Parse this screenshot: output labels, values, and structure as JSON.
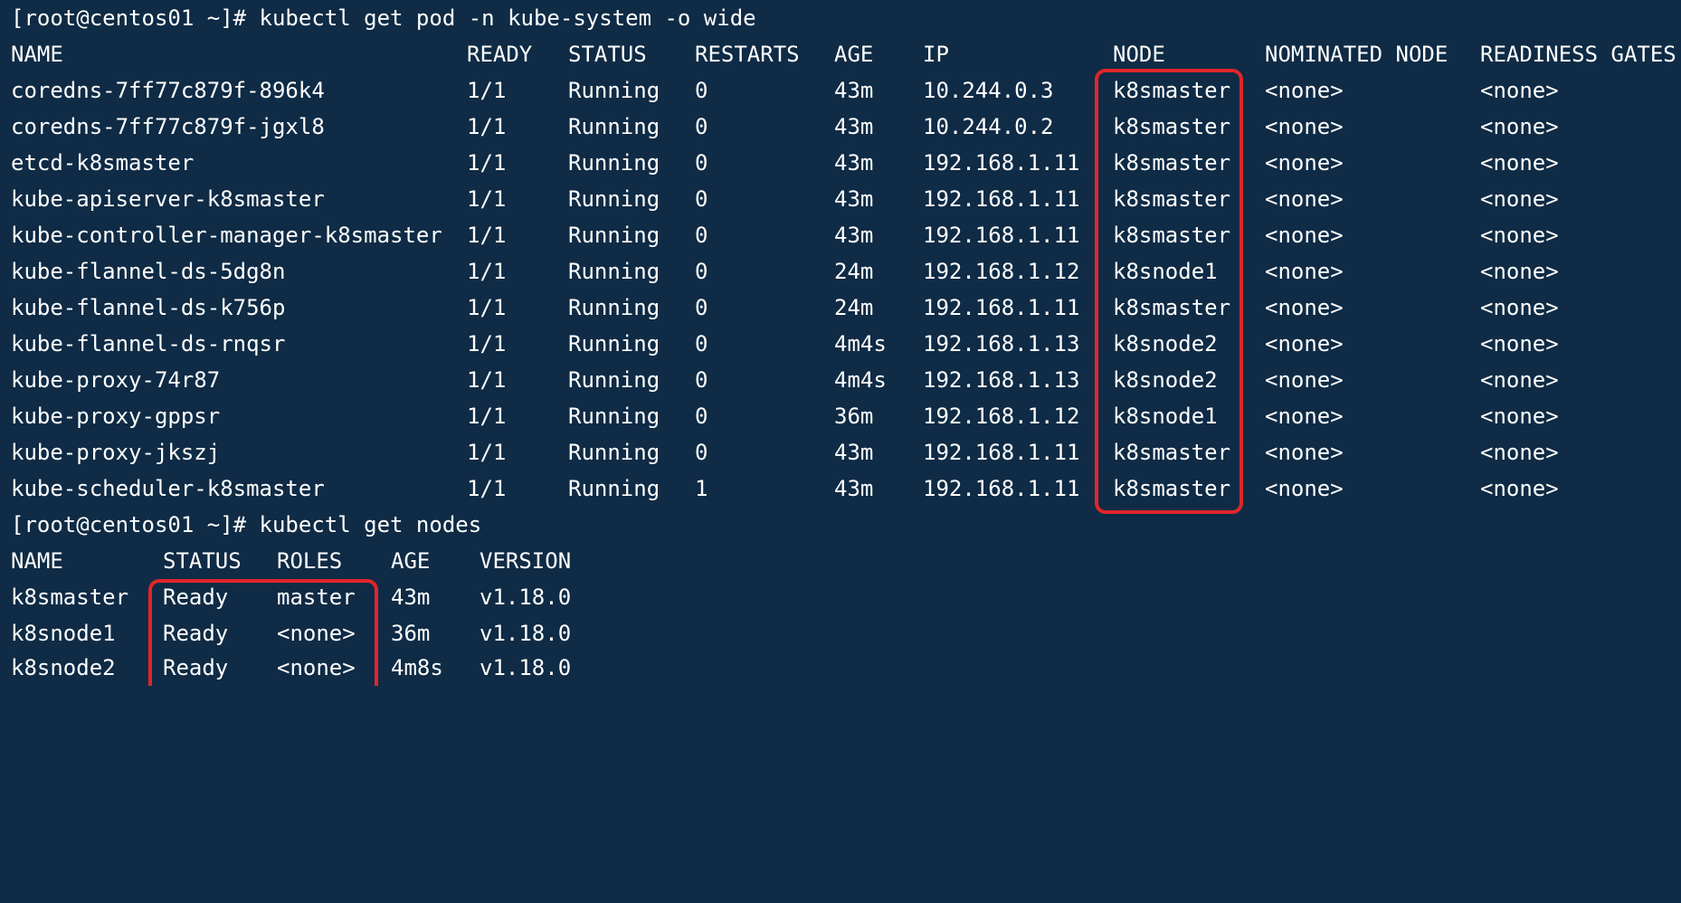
{
  "commands": {
    "pods": "[root@centos01 ~]# kubectl get pod -n kube-system -o wide",
    "nodes": "[root@centos01 ~]# kubectl get nodes"
  },
  "pods": {
    "headers": [
      "NAME",
      "READY",
      "STATUS",
      "RESTARTS",
      "AGE",
      "IP",
      "NODE",
      "NOMINATED NODE",
      "READINESS GATES"
    ],
    "rows": [
      [
        "coredns-7ff77c879f-896k4",
        "1/1",
        "Running",
        "0",
        "43m",
        "10.244.0.3",
        "k8smaster",
        "<none>",
        "<none>"
      ],
      [
        "coredns-7ff77c879f-jgxl8",
        "1/1",
        "Running",
        "0",
        "43m",
        "10.244.0.2",
        "k8smaster",
        "<none>",
        "<none>"
      ],
      [
        "etcd-k8smaster",
        "1/1",
        "Running",
        "0",
        "43m",
        "192.168.1.11",
        "k8smaster",
        "<none>",
        "<none>"
      ],
      [
        "kube-apiserver-k8smaster",
        "1/1",
        "Running",
        "0",
        "43m",
        "192.168.1.11",
        "k8smaster",
        "<none>",
        "<none>"
      ],
      [
        "kube-controller-manager-k8smaster",
        "1/1",
        "Running",
        "0",
        "43m",
        "192.168.1.11",
        "k8smaster",
        "<none>",
        "<none>"
      ],
      [
        "kube-flannel-ds-5dg8n",
        "1/1",
        "Running",
        "0",
        "24m",
        "192.168.1.12",
        "k8snode1",
        "<none>",
        "<none>"
      ],
      [
        "kube-flannel-ds-k756p",
        "1/1",
        "Running",
        "0",
        "24m",
        "192.168.1.11",
        "k8smaster",
        "<none>",
        "<none>"
      ],
      [
        "kube-flannel-ds-rnqsr",
        "1/1",
        "Running",
        "0",
        "4m4s",
        "192.168.1.13",
        "k8snode2",
        "<none>",
        "<none>"
      ],
      [
        "kube-proxy-74r87",
        "1/1",
        "Running",
        "0",
        "4m4s",
        "192.168.1.13",
        "k8snode2",
        "<none>",
        "<none>"
      ],
      [
        "kube-proxy-gppsr",
        "1/1",
        "Running",
        "0",
        "36m",
        "192.168.1.12",
        "k8snode1",
        "<none>",
        "<none>"
      ],
      [
        "kube-proxy-jkszj",
        "1/1",
        "Running",
        "0",
        "43m",
        "192.168.1.11",
        "k8smaster",
        "<none>",
        "<none>"
      ],
      [
        "kube-scheduler-k8smaster",
        "1/1",
        "Running",
        "1",
        "43m",
        "192.168.1.11",
        "k8smaster",
        "<none>",
        "<none>"
      ]
    ]
  },
  "nodes": {
    "headers": [
      "NAME",
      "STATUS",
      "ROLES",
      "AGE",
      "VERSION"
    ],
    "rows": [
      [
        "k8smaster",
        "Ready",
        "master",
        "43m",
        "v1.18.0"
      ],
      [
        "k8snode1",
        "Ready",
        "<none>",
        "36m",
        "v1.18.0"
      ],
      [
        "k8snode2",
        "Ready",
        "<none>",
        "4m8s",
        "v1.18.0"
      ]
    ]
  },
  "colors": {
    "background": "#0f2b45",
    "text": "#ffffff",
    "highlight": "#e0262a"
  }
}
